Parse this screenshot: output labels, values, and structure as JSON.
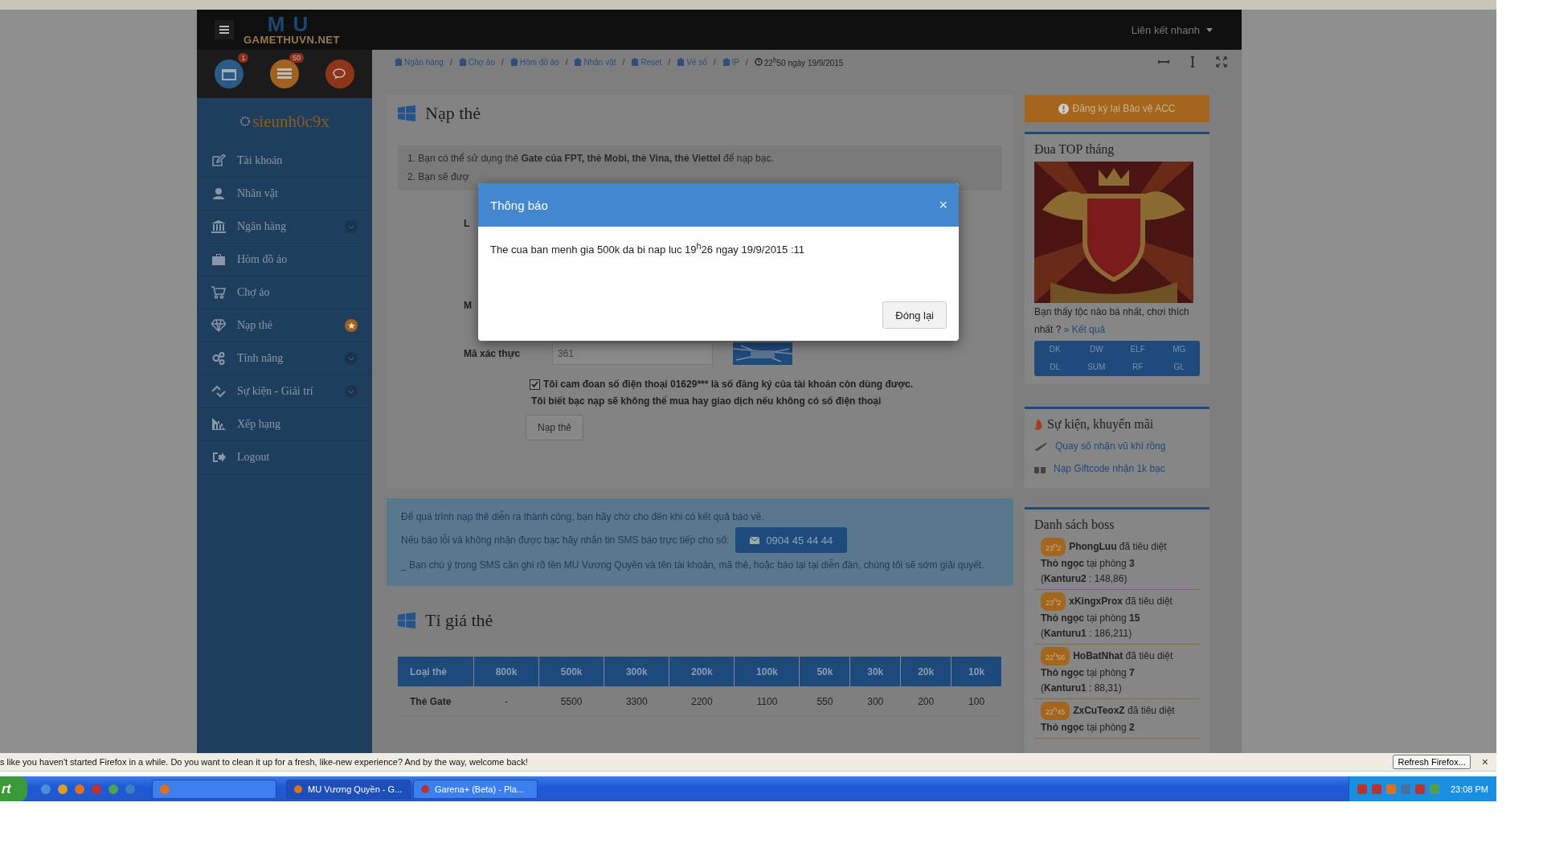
{
  "header": {
    "logo_backdrop": "MU",
    "logo": "GAMETHUVN.NET",
    "quick_links": "Liên kết nhanh"
  },
  "notification_badges": [
    "1",
    "50"
  ],
  "user": {
    "name": "sieunh0c9x"
  },
  "sidebar": {
    "items": [
      {
        "label": "Tài khoản",
        "kind": "plain"
      },
      {
        "label": "Nhân vật",
        "kind": "plain"
      },
      {
        "label": "Ngân hàng",
        "kind": "expandable"
      },
      {
        "label": "Hòm đồ ảo",
        "kind": "plain"
      },
      {
        "label": "Chợ ảo",
        "kind": "plain"
      },
      {
        "label": "Nạp thẻ",
        "kind": "starred"
      },
      {
        "label": "Tính năng",
        "kind": "expandable"
      },
      {
        "label": "Sự kiện - Giải trí",
        "kind": "expandable"
      },
      {
        "label": "Xếp hạng",
        "kind": "plain"
      },
      {
        "label": "Logout",
        "kind": "plain"
      }
    ]
  },
  "breadcrumb": [
    "Ngân hàng",
    "Chợ ảo",
    "Hòm đồ ảo",
    "Nhân vật",
    "Reset",
    "Vé số",
    "IP"
  ],
  "breadcrumb_separators": [
    "/",
    "/",
    "/",
    "/",
    "/",
    "/",
    "/"
  ],
  "clock": "22$^{h}$50 ngày 19/9/2015",
  "recharge": {
    "title": "Nạp thẻ",
    "notes": [
      "1. Bạn có thể sử dụng thẻ **Gate của FPT, thẻ Mobi, thẻ Vina, thẻ Viettel** để nạp bạc.",
      "2. Bạn sẽ đượ"
    ],
    "partial_labels": [
      "L",
      "M"
    ],
    "captcha_label": "Mã xác thực",
    "captcha_value": "361",
    "agree": {
      "checked": true,
      "text": "Tôi cam đoan số điện thoại 01629*** là số đăng ký của tài khoản còn dùng được.",
      "text2": "Tôi biết bạc nạp sẽ không thể mua hay giao dịch nếu không có số điện thoại"
    },
    "submit": "Nạp thẻ"
  },
  "info": {
    "lines": [
      "Để quá trình nạp thẻ diễn ra thành công, bạn hãy chờ cho đến khi có kết quả báo về.",
      "Nếu báo lỗi và không nhận được bạc hãy nhắn tin SMS báo trực tiếp cho số:"
    ],
    "phone": "0904 45 44 44",
    "note": "_ Bạn chú ý trong SMS cần ghi rõ tên MU Vương Quyền và tên tài khoản, mã thẻ, hoặc báo lại tại diễn đàn, chúng tôi sẽ sớm giải quyết."
  },
  "rates": {
    "title": "Tỉ giá thẻ",
    "columns": [
      "Loại thẻ",
      "800k",
      "500k",
      "300k",
      "200k",
      "100k",
      "50k",
      "30k",
      "20k",
      "10k"
    ],
    "rows": [
      [
        "Thẻ Gate",
        "-",
        "5500",
        "3300",
        "2200",
        "1100",
        "550",
        "300",
        "200",
        "100"
      ]
    ]
  },
  "modal": {
    "title": "Thông báo",
    "close": "×",
    "message": "The cua ban menh gia 500k da bi nap luc 19$^{h}$26 ngay 19/9/2015 :11",
    "button": "Đóng lại"
  },
  "right": {
    "protect_button": "Đăng ký lại Bảo vệ ACC",
    "top_month": {
      "title": "Đua TOP tháng",
      "question": "Bạn thấy tộc nào bá nhất, chơi thích nhất ?",
      "result_link": "» Kết quả",
      "classes": [
        "DK",
        "DW",
        "ELF",
        "MG",
        "DL",
        "SUM",
        "RF",
        "GL"
      ]
    },
    "events": {
      "title": "Sự kiện, khuyến mãi",
      "items": [
        "Quay số nhận vũ khí rồng",
        "Nạp Giftcode nhận 1k bạc"
      ]
    },
    "bosses": {
      "title": "Danh sách boss",
      "entries": [
        {
          "time": "23$^{h}$2",
          "lines": [
            "**PhongLuu** đã tiêu diệt",
            "**Thỏ ngọc** tại phòng **3**",
            "(**Kanturu2** : 148,86)"
          ]
        },
        {
          "time": "23$^{h}$2",
          "lines": [
            "**xKingxProx** đã tiêu diệt",
            "**Thỏ ngọc** tại phòng **15**",
            "(**Kanturu1** : 186,211)"
          ]
        },
        {
          "time": "22$^{h}$56",
          "lines": [
            "**HoBatNhat** đã tiêu diệt",
            "**Thỏ ngọc** tại phòng **7**",
            "(**Kanturu1** : 88,31)"
          ]
        },
        {
          "time": "22$^{h}$45",
          "lines": [
            "**ZxCuTeoxZ** đã tiêu diệt",
            "**Thỏ ngọc** tại phòng **2**"
          ]
        }
      ]
    }
  },
  "firefox_bar": {
    "message": "s like you haven't started Firefox in a while. Do you want to clean it up for a fresh, like-new experience? And by the way, welcome back!",
    "button": "Refresh Firefox...",
    "close": "×"
  },
  "taskbar": {
    "start": "rt",
    "tasks": [
      "MU Vương Quyền - G...",
      "Garena+ (Beta) - Pla..."
    ],
    "clock": "23:08 PM"
  }
}
